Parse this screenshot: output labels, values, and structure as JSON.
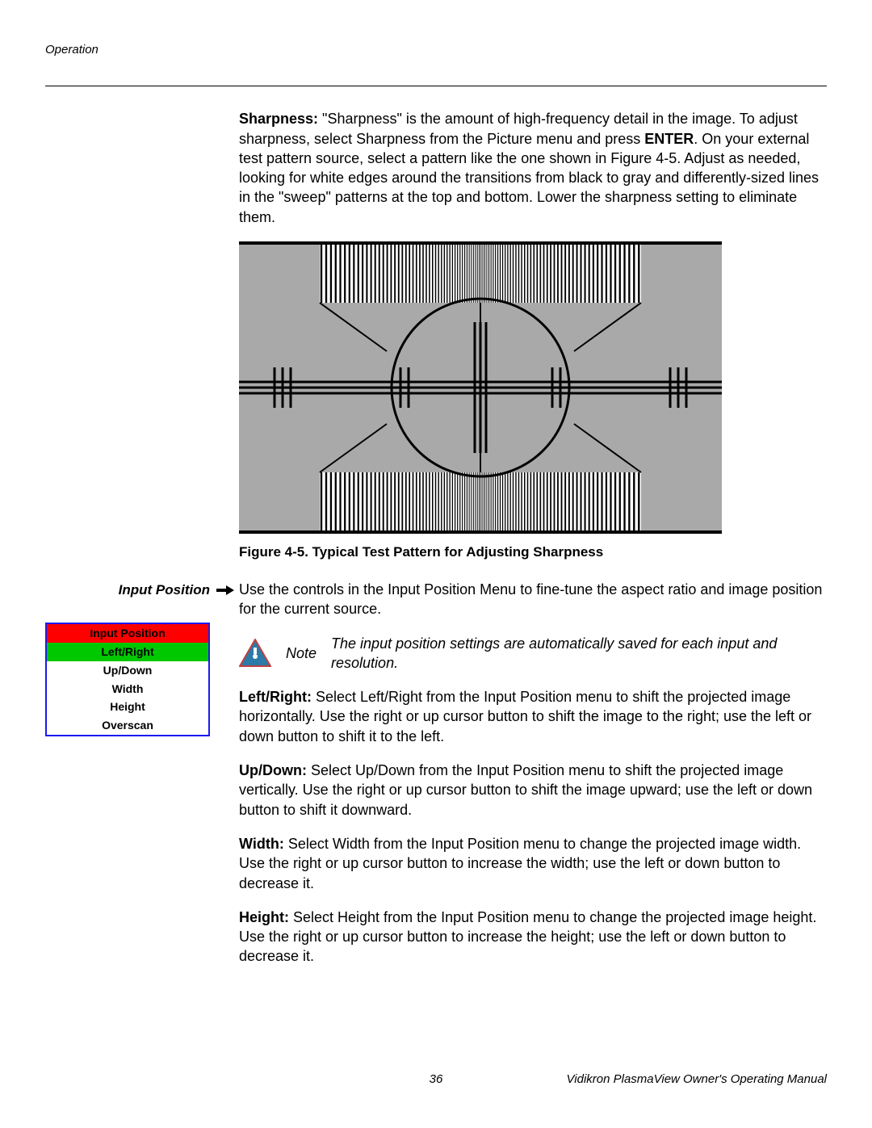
{
  "header": {
    "section": "Operation"
  },
  "sharpness": {
    "label": "Sharpness:",
    "body_before_enter": " \"Sharpness\" is the amount of high-frequency detail in the image. To adjust sharpness, select Sharpness from the Picture menu and press ",
    "enter": "ENTER",
    "body_after_enter": ". On your external test pattern source, select a pattern like the one shown in Figure 4-5. Adjust as needed, looking for white edges around the transitions from black to gray and differently-sized lines in the \"sweep\" patterns at the top and bottom. Lower the sharpness setting to eliminate them."
  },
  "figure_caption": "Figure 4-5. Typical Test Pattern for Adjusting Sharpness",
  "input_position": {
    "side_label": "Input Position",
    "intro": "Use the controls in the Input Position Menu to fine-tune the aspect ratio and image position for the current source.",
    "menu": {
      "title": "Input Position",
      "selected": "Left/Right",
      "items": [
        "Up/Down",
        "Width",
        "Height",
        "Overscan"
      ]
    },
    "note": {
      "label": "Note",
      "text": "The input position settings are automatically saved for each input and resolution."
    },
    "left_right": {
      "label": "Left/Right:",
      "body": " Select Left/Right from the Input Position menu to shift the projected image horizontally. Use the right or up cursor button to shift the image to the right; use the left or down button to shift it to the left."
    },
    "up_down": {
      "label": "Up/Down:",
      "body": " Select Up/Down from the Input Position menu to shift the projected image vertically. Use the right or up cursor button to shift the image upward; use the left or down button to shift it downward."
    },
    "width": {
      "label": "Width:",
      "body": " Select Width from the Input Position menu to change the projected image width. Use the right or up cursor button to increase the width; use the left or down button to decrease it."
    },
    "height": {
      "label": "Height:",
      "body": " Select Height from the Input Position menu to change the projected image height. Use the right or up cursor button to increase the height; use the left or down button to decrease it."
    }
  },
  "footer": {
    "page_number": "36",
    "manual_title": "Vidikron PlasmaView Owner's Operating Manual"
  }
}
